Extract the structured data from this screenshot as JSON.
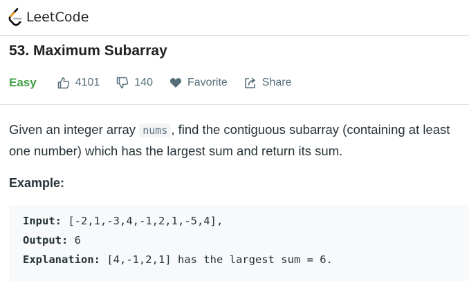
{
  "app": {
    "logo_text": "LeetCode"
  },
  "problem": {
    "title": "53. Maximum Subarray",
    "difficulty": "Easy",
    "likes": "4101",
    "dislikes": "140",
    "favorite_label": "Favorite",
    "share_label": "Share",
    "description_before": "Given an integer array ",
    "description_code": "nums",
    "description_after": ", find the contiguous subarray (containing at least one number) which has the largest sum and return its sum."
  },
  "example": {
    "heading": "Example:",
    "input_label": "Input:",
    "input_value": " [-2,1,-3,4,-1,2,1,-5,4],",
    "output_label": "Output:",
    "output_value": " 6",
    "explanation_label": "Explanation:",
    "explanation_value": " [4,-1,2,1] has the largest sum = 6."
  },
  "colors": {
    "difficulty_easy": "#43a047",
    "logo_orange": "#f89f1b",
    "logo_gray": "#b3b3b3",
    "logo_dark": "#070706"
  },
  "icons": [
    "leetcode-logo-icon",
    "thumbs-up-icon",
    "thumbs-down-icon",
    "heart-icon",
    "share-icon"
  ]
}
